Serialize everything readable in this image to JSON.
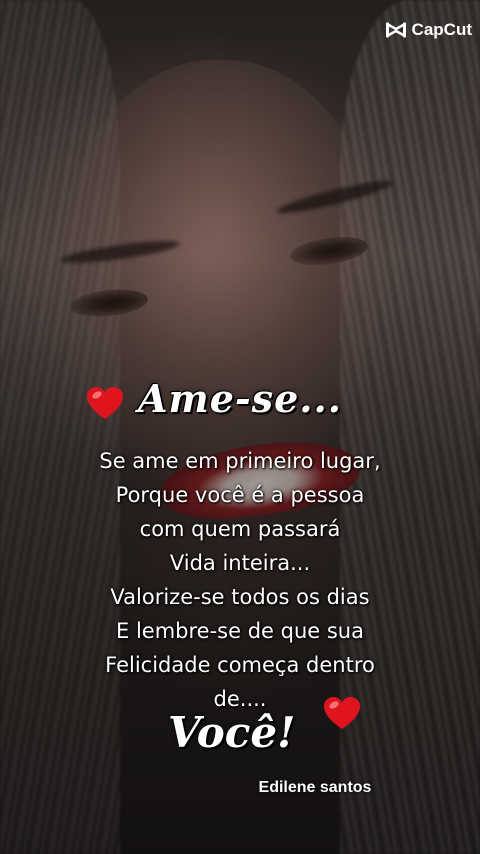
{
  "watermark": {
    "brand": "CapCut",
    "icon": "capcut-logo-icon"
  },
  "quote": {
    "heading": "Ame-se...",
    "lines": [
      "Se ame em primeiro lugar,",
      "Porque você é a pessoa",
      "com quem passará",
      "Vida inteira...",
      "Valorize-se todos os dias",
      "E lembre-se de que sua",
      "Felicidade começa dentro",
      "de...."
    ],
    "closing": "Você!",
    "signature": "Edilene santos"
  },
  "decorations": {
    "heart_icon": "heart-icon",
    "heart_color": "#e0141e"
  }
}
